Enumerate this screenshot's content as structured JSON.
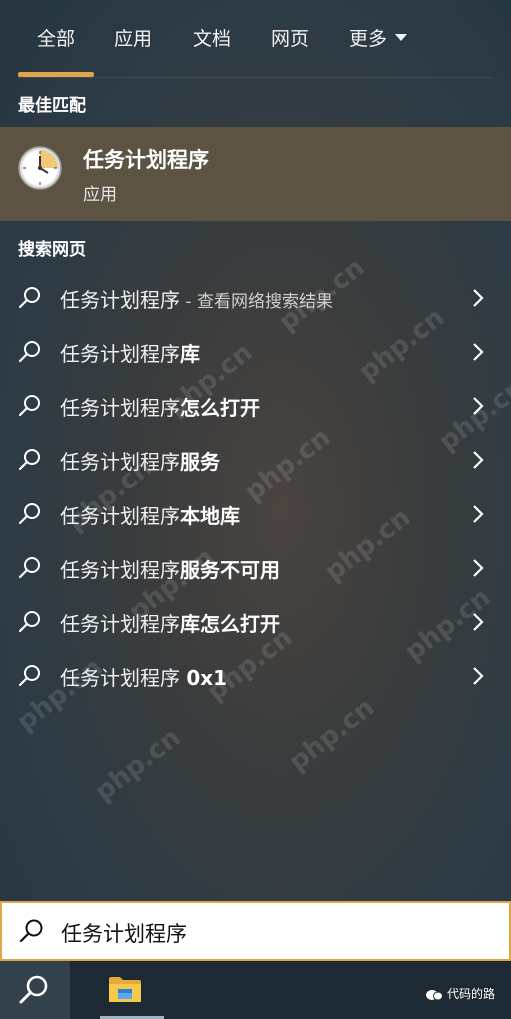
{
  "tabs": [
    {
      "label": "全部",
      "active": true
    },
    {
      "label": "应用"
    },
    {
      "label": "文档"
    },
    {
      "label": "网页"
    },
    {
      "label": "更多"
    }
  ],
  "best_match": {
    "heading": "最佳匹配",
    "title": "任务计划程序",
    "subtitle": "应用",
    "icon": "clock-icon"
  },
  "web_search": {
    "heading": "搜索网页",
    "results": [
      {
        "base": "任务计划程序",
        "suffix": " - 查看网络搜索结果"
      },
      {
        "base": "任务计划程序",
        "bold": "库"
      },
      {
        "base": "任务计划程序",
        "bold": "怎么打开"
      },
      {
        "base": "任务计划程序",
        "bold": "服务"
      },
      {
        "base": "任务计划程序",
        "bold": "本地库"
      },
      {
        "base": "任务计划程序",
        "bold": "服务不可用"
      },
      {
        "base": "任务计划程序",
        "bold": "库怎么打开"
      },
      {
        "base": "任务计划程序 ",
        "bold": "0x1"
      }
    ]
  },
  "search": {
    "query": "任务计划程序",
    "icon": "search-icon"
  },
  "taskbar": {
    "search_icon": "search-icon",
    "folder_icon": "file-explorer-icon",
    "wechat_label": "代码的路"
  },
  "watermark": "php.cn",
  "colors": {
    "accent": "#e0a449",
    "best_match_bg": "#5c5343"
  }
}
